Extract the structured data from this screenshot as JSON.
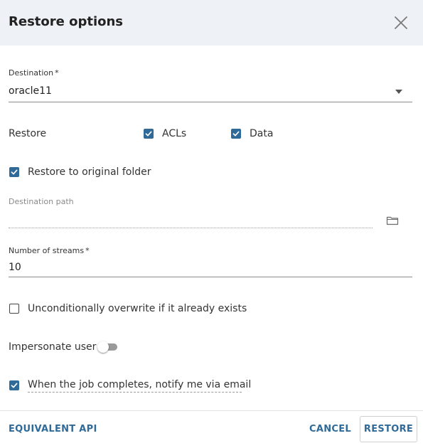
{
  "dialog": {
    "title": "Restore options",
    "close_icon": "close-icon"
  },
  "destination": {
    "label": "Destination",
    "required_mark": "*",
    "value": "oracle11",
    "dropdown_icon": "caret-down-icon"
  },
  "restore": {
    "label": "Restore",
    "acls": {
      "label": "ACLs",
      "checked": true
    },
    "data": {
      "label": "Data",
      "checked": true
    }
  },
  "restore_original": {
    "label": "Restore to original folder",
    "checked": true
  },
  "destination_path": {
    "label": "Destination path",
    "value": "",
    "browse_icon": "folder-icon"
  },
  "streams": {
    "label": "Number of streams",
    "required_mark": "*",
    "value": "10"
  },
  "overwrite": {
    "label": "Unconditionally overwrite if it already exists",
    "checked": false
  },
  "impersonate": {
    "label": "Impersonate user",
    "enabled": false
  },
  "notify": {
    "label": "When the job completes, notify me via email",
    "checked": true
  },
  "footer": {
    "equivalent_api": "EQUIVALENT API",
    "cancel": "CANCEL",
    "restore": "RESTORE"
  },
  "colors": {
    "accent": "#2f6a98",
    "header_bg": "#eef1f5"
  }
}
